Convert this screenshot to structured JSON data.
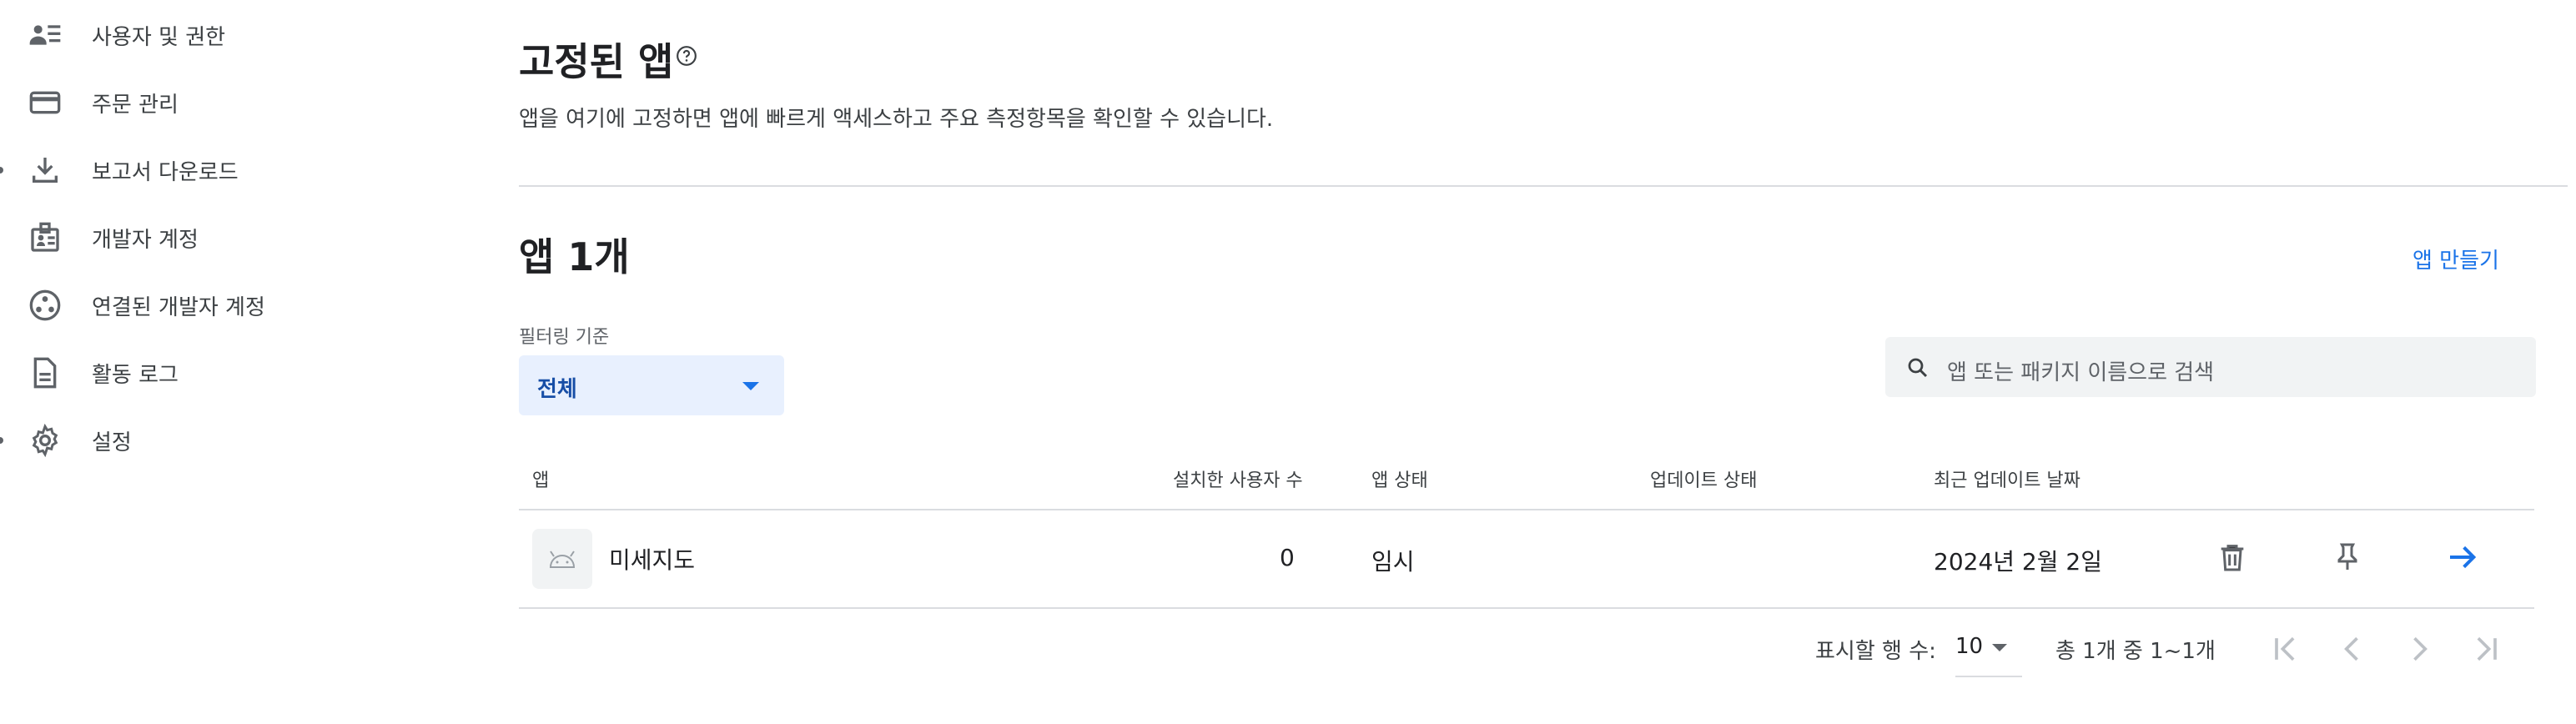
{
  "sidebar": {
    "items": [
      {
        "label": "사용자 및 권한",
        "icon": "users-list-icon"
      },
      {
        "label": "주문 관리",
        "icon": "credit-card-icon"
      },
      {
        "label": "보고서 다운로드",
        "icon": "download-icon"
      },
      {
        "label": "개발자 계정",
        "icon": "developer-badge-icon"
      },
      {
        "label": "연결된 개발자 계정",
        "icon": "linked-accounts-icon"
      },
      {
        "label": "활동 로그",
        "icon": "document-icon"
      },
      {
        "label": "설정",
        "icon": "gear-icon"
      }
    ]
  },
  "pinned": {
    "title": "고정된 앱",
    "description": "앱을 여기에 고정하면 앱에 빠르게 액세스하고 주요 측정항목을 확인할 수 있습니다."
  },
  "apps": {
    "title": "앱 1개",
    "create_label": "앱 만들기",
    "filter_label": "필터링 기준",
    "filter_value": "전체",
    "search_placeholder": "앱 또는 패키지 이름으로 검색"
  },
  "table": {
    "headers": {
      "app": "앱",
      "installs": "설치한 사용자 수",
      "app_status": "앱 상태",
      "update_status": "업데이트 상태",
      "last_updated": "최근 업데이트 날짜"
    },
    "rows": [
      {
        "name": "미세지도",
        "installs": "0",
        "app_status": "임시",
        "update_status": "",
        "last_updated": "2024년 2월 2일"
      }
    ]
  },
  "pagination": {
    "rows_label": "표시할 행 수:",
    "rows_value": "10",
    "range": "총 1개 중 1~1개"
  },
  "colors": {
    "accent": "#1a73e8",
    "filter_bg": "#e8f0fe",
    "search_bg": "#f1f3f4"
  }
}
